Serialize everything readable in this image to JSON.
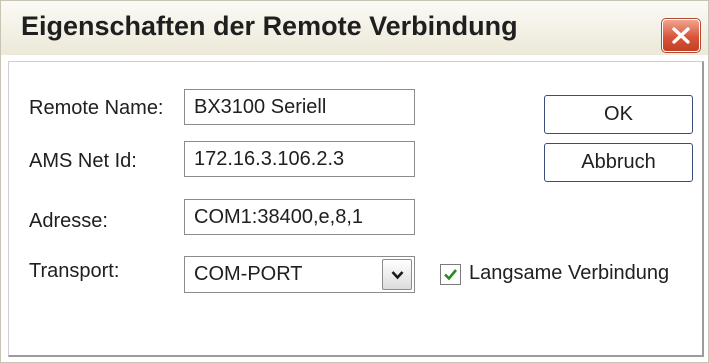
{
  "window": {
    "title": "Eigenschaften der Remote Verbindung"
  },
  "form": {
    "remote_name": {
      "label": "Remote Name:",
      "value": "BX3100 Seriell"
    },
    "ams_net_id": {
      "label": "AMS Net Id:",
      "value": "172.16.3.106.2.3"
    },
    "adresse": {
      "label": "Adresse:",
      "value": "COM1:38400,e,8,1"
    },
    "transport": {
      "label": "Transport:",
      "value": "COM-PORT"
    },
    "langsame_verbindung": {
      "label": "Langsame Verbindung",
      "checked": true
    }
  },
  "buttons": {
    "ok": "OK",
    "abbruch": "Abbruch"
  },
  "icons": {
    "close": "close-x-icon",
    "dropdown": "chevron-down-icon",
    "check": "checkmark-icon"
  },
  "colors": {
    "close_button": "#d8553a",
    "check_mark": "#2a8a1f",
    "button_border": "#3c4d7a"
  }
}
